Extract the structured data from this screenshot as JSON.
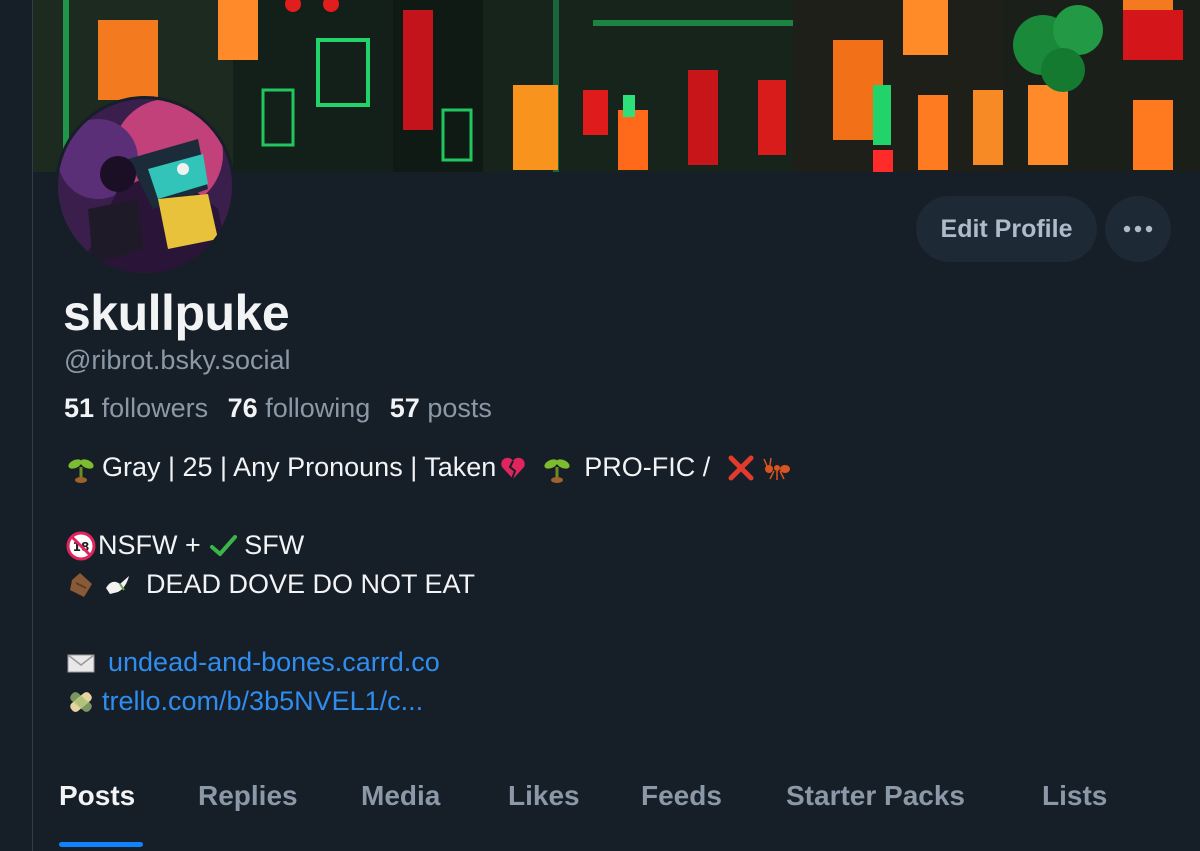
{
  "profile": {
    "display_name": "skullpuke",
    "handle": "@ribrot.bsky.social",
    "followers_count": "51",
    "followers_label": "followers",
    "following_count": "76",
    "following_label": "following",
    "posts_count": "57",
    "posts_label": "posts"
  },
  "actions": {
    "edit_label": "Edit Profile",
    "more_label": "•••"
  },
  "bio": {
    "line1_a": "Gray | 25 | Any Pronouns | Taken",
    "line1_b": "PRO-FIC / ",
    "line2_a": "NSFW + ",
    "line2_b": "SFW",
    "line3": "DEAD DOVE DO NOT EAT",
    "link1": "undead-and-bones.carrd.co",
    "link2": "trello.com/b/3b5NVEL1/c..."
  },
  "tabs": [
    {
      "label": "Posts",
      "active": true
    },
    {
      "label": "Replies"
    },
    {
      "label": "Media"
    },
    {
      "label": "Likes"
    },
    {
      "label": "Feeds"
    },
    {
      "label": "Starter Packs"
    },
    {
      "label": "Lists"
    }
  ],
  "icons": {
    "seedling": "seedling-icon",
    "heart": "broken-heart-icon",
    "cross": "cross-mark-icon",
    "ant": "ant-icon",
    "no18": "no-under-18-icon",
    "check": "check-mark-icon",
    "coffin": "coffin-icon",
    "dove": "dove-icon",
    "envelope": "envelope-icon",
    "bandage": "bandage-icon",
    "more": "ellipsis-icon"
  },
  "colors": {
    "background": "#161e27",
    "link": "#2f8df0",
    "accent": "#1083fe",
    "muted": "#8b98a7"
  }
}
